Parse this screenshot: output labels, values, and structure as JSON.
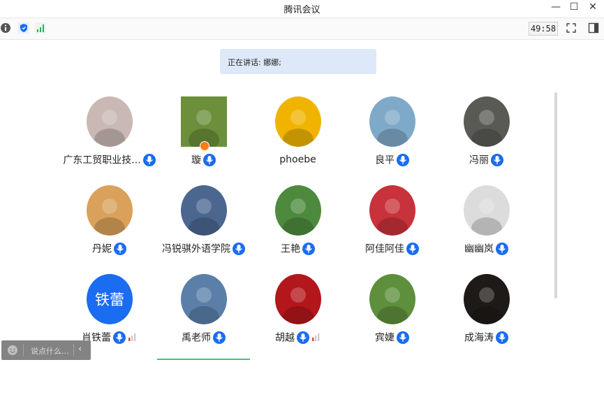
{
  "window": {
    "title": "腾讯会议",
    "min_icon": "minimize-icon",
    "max_icon": "maximize-icon",
    "close_icon": "close-icon"
  },
  "toolbar": {
    "info_icon": "info-icon",
    "shield_icon": "shield-icon",
    "signal_icon": "signal-icon",
    "timer": "49:58",
    "fullscreen_icon": "fullscreen-icon",
    "sidebar_icon": "sidebar-toggle-icon"
  },
  "speaking": {
    "text": "正在讲话: 娜娜;"
  },
  "participants": [
    {
      "name": "广东工贸职业技...",
      "avatar_color": "#c9b8b3"
    },
    {
      "name": "璇",
      "avatar_color": "#6b8f3a",
      "host": true
    },
    {
      "name": "phoebe",
      "avatar_color": "#f0b400",
      "no_mic": true
    },
    {
      "name": "良平",
      "avatar_color": "#7fa9c9"
    },
    {
      "name": "冯丽",
      "avatar_color": "#5a5a55"
    },
    {
      "name": "丹妮",
      "avatar_color": "#d9a15a"
    },
    {
      "name": "冯锐骐外语学院",
      "avatar_color": "#4b6790"
    },
    {
      "name": "王艳",
      "avatar_color": "#4e8a3e"
    },
    {
      "name": "阿佳阿佳",
      "avatar_color": "#c8323a"
    },
    {
      "name": "幽幽岚",
      "avatar_color": "#dcdcdc"
    },
    {
      "name": "肖铁蕾",
      "avatar_color": "#1a6cf0",
      "avatar_text": "铁蕾",
      "signal": true
    },
    {
      "name": "禹老师",
      "avatar_color": "#5b7fa8"
    },
    {
      "name": "胡越",
      "avatar_color": "#b3161b",
      "signal": true
    },
    {
      "name": "宾婕",
      "avatar_color": "#5e8f3c"
    },
    {
      "name": "成海涛",
      "avatar_color": "#1e1a18"
    }
  ],
  "chat": {
    "placeholder": "说点什么...",
    "smile_icon": "emoji-icon",
    "collapse_icon": "chevron-left-icon"
  },
  "colors": {
    "accent": "#1a6cf0",
    "speaking_bg": "#dde9f9",
    "active_line": "#46c27a",
    "signal_red": "#e54545"
  }
}
